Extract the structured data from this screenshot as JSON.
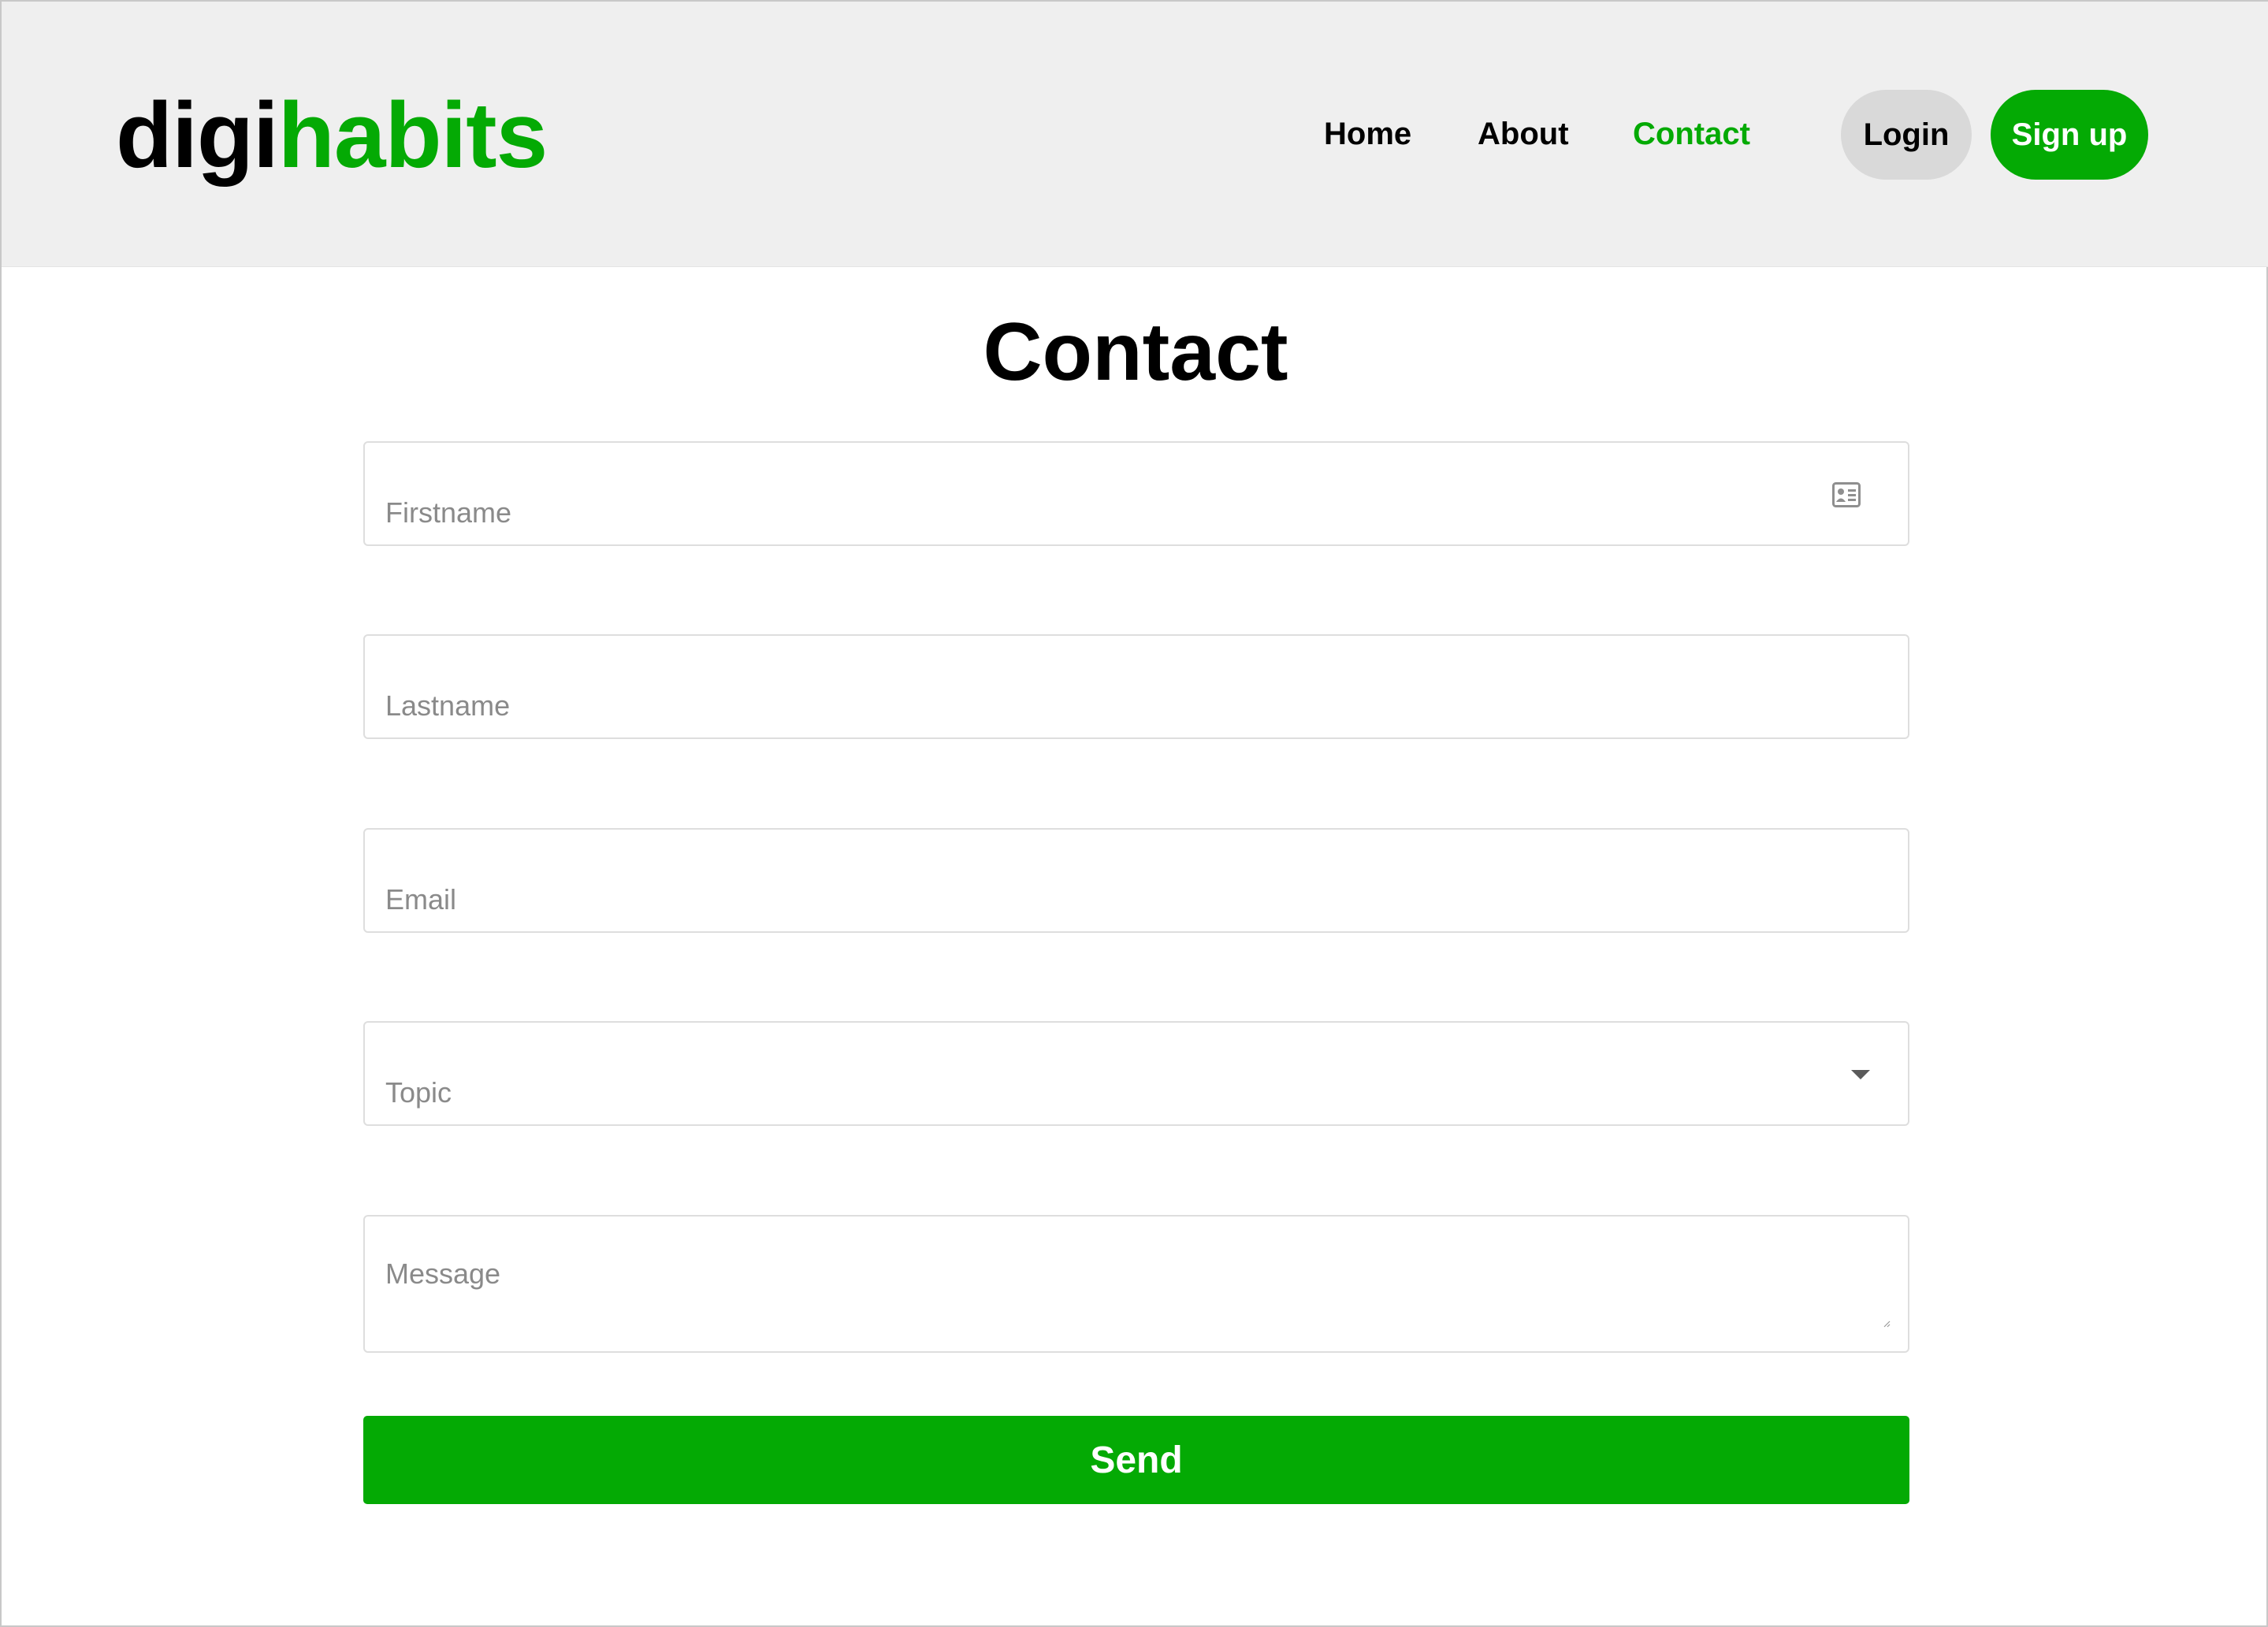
{
  "brand": {
    "logo_part_1": "digi",
    "logo_part_2": "habits",
    "primary_color": "#04aa04",
    "dark_color": "#000000"
  },
  "nav": {
    "items": [
      {
        "label": "Home",
        "active": false
      },
      {
        "label": "About",
        "active": false
      },
      {
        "label": "Contact",
        "active": true
      }
    ],
    "login_label": "Login",
    "signup_label": "Sign up"
  },
  "page": {
    "title": "Contact"
  },
  "form": {
    "firstname": {
      "placeholder": "Firstname",
      "value": "",
      "icon": "contact-card-icon"
    },
    "lastname": {
      "placeholder": "Lastname",
      "value": ""
    },
    "email": {
      "placeholder": "Email",
      "value": ""
    },
    "topic": {
      "placeholder": "Topic",
      "selected": "Topic",
      "icon": "chevron-down-icon"
    },
    "message": {
      "placeholder": "Message",
      "value": ""
    },
    "submit_label": "Send"
  }
}
